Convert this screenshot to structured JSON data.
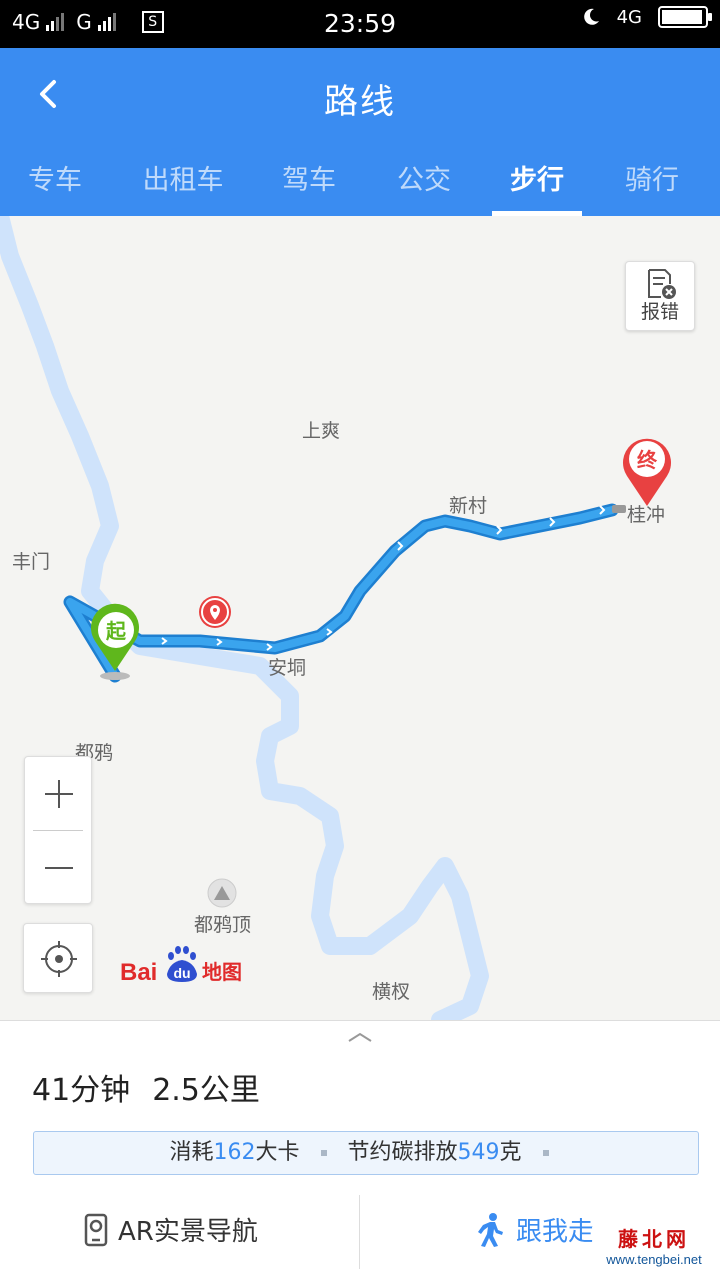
{
  "status_bar": {
    "network_left": "4G",
    "network_right": "G",
    "sim_icon_text": "S",
    "time": "23:59",
    "network_badge": "4G",
    "battery_level": 0.95
  },
  "header": {
    "title": "路线",
    "back_icon": "chevron-left-icon",
    "tabs": [
      {
        "label": "专车",
        "active": false
      },
      {
        "label": "出租车",
        "active": false
      },
      {
        "label": "驾车",
        "active": false
      },
      {
        "label": "公交",
        "active": false
      },
      {
        "label": "步行",
        "active": true
      },
      {
        "label": "骑行",
        "active": false
      }
    ]
  },
  "map": {
    "report_label": "报错",
    "places": [
      "上爽",
      "新村",
      "丰门",
      "安垌",
      "都鸦",
      "都鸦顶",
      "横杈",
      "桂冲"
    ],
    "start_label": "起",
    "end_label": "终",
    "logo_text_left": "Bai",
    "logo_text_mid": "du",
    "logo_text_right": "地图",
    "colors": {
      "route": "#2f9ae8",
      "river": "#cfe3fb",
      "start": "#5fb71c",
      "end": "#e84141"
    }
  },
  "route": {
    "duration": "41分钟",
    "distance": "2.5公里",
    "calories_prefix": "消耗",
    "calories_value": "162",
    "calories_unit": "大卡",
    "carbon_prefix": "节约碳排放",
    "carbon_value": "549",
    "carbon_unit": "克"
  },
  "actions": {
    "ar_label": "AR实景导航",
    "follow_label": "跟我走"
  },
  "watermark": {
    "line1": "藤北网",
    "line2": "www.tengbei.net"
  }
}
